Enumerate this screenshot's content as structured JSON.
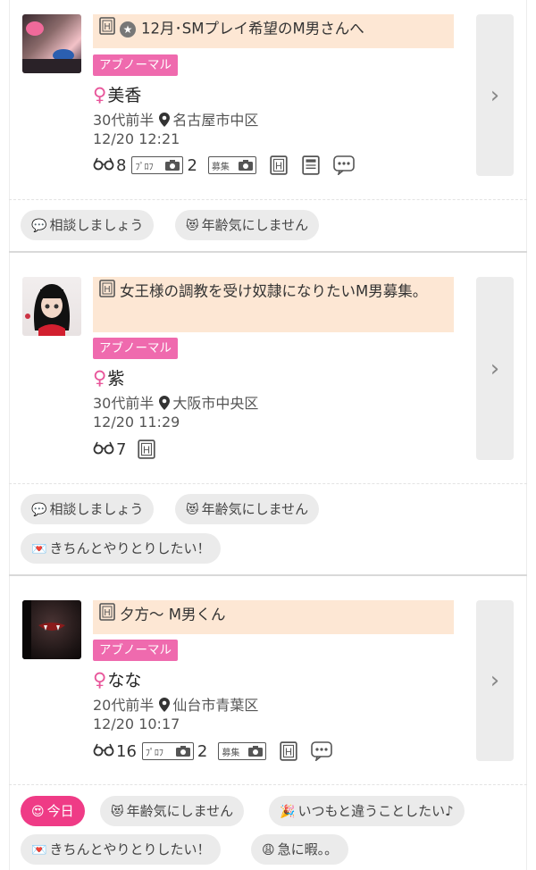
{
  "posts": [
    {
      "title": "12月･SMプレイ希望のM男さんへ",
      "tag": "アブノーマル",
      "name": "美香",
      "age": "30代前半",
      "location": "名古屋市中区",
      "datetime": "12/20 12:21",
      "views": "8",
      "prof_label": "ﾌﾟﾛﾌ",
      "photos": "2",
      "boshu_label": "募集",
      "chips": [
        {
          "emoji": "💬",
          "text": "相談しましょう"
        },
        {
          "emoji": "😻",
          "text": "年齢気にしません"
        }
      ]
    },
    {
      "title": "女王様の調教を受け奴隷になりたいM男募集。",
      "tag": "アブノーマル",
      "name": "紫",
      "age": "30代前半",
      "location": "大阪市中央区",
      "datetime": "12/20 11:29",
      "views": "7",
      "chips": [
        {
          "emoji": "💬",
          "text": "相談しましょう"
        },
        {
          "emoji": "😻",
          "text": "年齢気にしません"
        },
        {
          "emoji": "💌",
          "text": "きちんとやりとりしたい！"
        }
      ]
    },
    {
      "title": "夕方〜 M男くん",
      "tag": "アブノーマル",
      "name": "なな",
      "age": "20代前半",
      "location": "仙台市青葉区",
      "datetime": "12/20 10:17",
      "views": "16",
      "prof_label": "ﾌﾟﾛﾌ",
      "photos": "2",
      "boshu_label": "募集",
      "chips": [
        {
          "emoji": "😍",
          "text": "今日"
        },
        {
          "emoji": "😻",
          "text": "年齢気にしません"
        },
        {
          "emoji": "🎉",
          "text": "いつもと違うことしたい♪"
        },
        {
          "emoji": "💌",
          "text": "きちんとやりとりしたい！"
        },
        {
          "emoji": "😩",
          "text": "急に暇。。"
        }
      ]
    }
  ],
  "symbols": {
    "female": "♀",
    "chevron": "›",
    "star": "★",
    "h": "H"
  },
  "colors": {
    "tag_pink": "#ef6aae",
    "title_bg": "#fde7d4",
    "today_chip": "#ef3b86"
  }
}
